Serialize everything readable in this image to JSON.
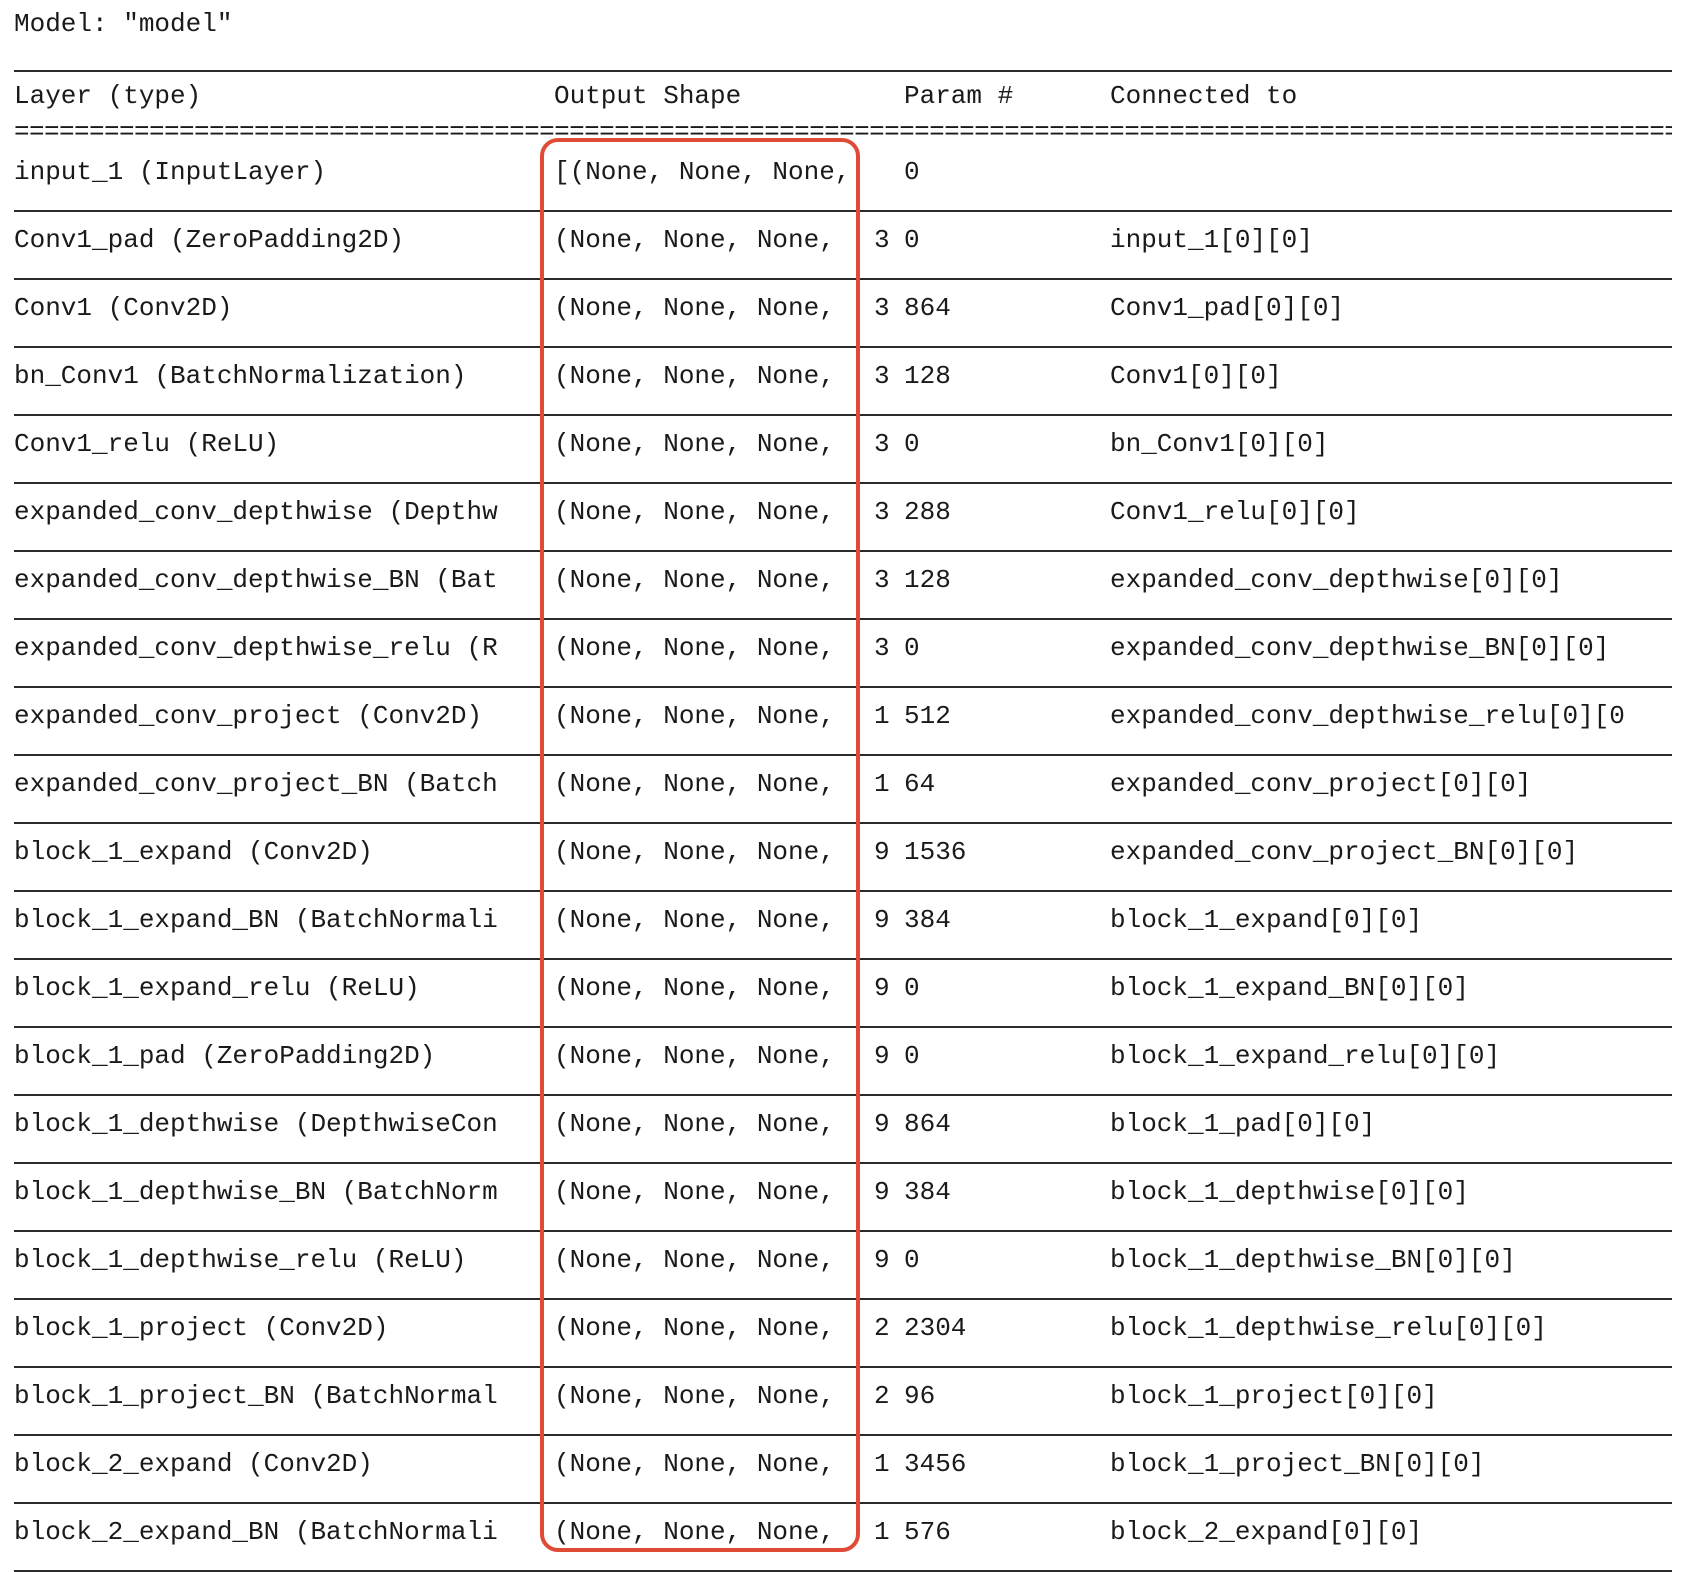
{
  "model_title": "Model: \"model\"",
  "header": {
    "layer_type": "Layer (type)",
    "output_shape": "Output Shape",
    "param": "Param #",
    "connected_to": "Connected to"
  },
  "separator": "==============================================================================================================================",
  "rows": [
    {
      "layer": "input_1 (InputLayer)",
      "shape": "[(None, None, None,",
      "shape_tail": "",
      "param": "0",
      "connected": ""
    },
    {
      "layer": "Conv1_pad (ZeroPadding2D)",
      "shape": "(None, None, None,",
      "shape_tail": "3",
      "param": "0",
      "connected": "input_1[0][0]"
    },
    {
      "layer": "Conv1 (Conv2D)",
      "shape": "(None, None, None,",
      "shape_tail": "3",
      "param": "864",
      "connected": "Conv1_pad[0][0]"
    },
    {
      "layer": "bn_Conv1 (BatchNormalization)",
      "shape": "(None, None, None,",
      "shape_tail": "3",
      "param": "128",
      "connected": "Conv1[0][0]"
    },
    {
      "layer": "Conv1_relu (ReLU)",
      "shape": "(None, None, None,",
      "shape_tail": "3",
      "param": "0",
      "connected": "bn_Conv1[0][0]"
    },
    {
      "layer": "expanded_conv_depthwise (Depthw",
      "shape": "(None, None, None,",
      "shape_tail": "3",
      "param": "288",
      "connected": "Conv1_relu[0][0]"
    },
    {
      "layer": "expanded_conv_depthwise_BN (Bat",
      "shape": "(None, None, None,",
      "shape_tail": "3",
      "param": "128",
      "connected": "expanded_conv_depthwise[0][0]"
    },
    {
      "layer": "expanded_conv_depthwise_relu (R",
      "shape": "(None, None, None,",
      "shape_tail": "3",
      "param": "0",
      "connected": "expanded_conv_depthwise_BN[0][0]"
    },
    {
      "layer": "expanded_conv_project (Conv2D)",
      "shape": "(None, None, None,",
      "shape_tail": "1",
      "param": "512",
      "connected": "expanded_conv_depthwise_relu[0][0"
    },
    {
      "layer": "expanded_conv_project_BN (Batch",
      "shape": "(None, None, None,",
      "shape_tail": "1",
      "param": "64",
      "connected": "expanded_conv_project[0][0]"
    },
    {
      "layer": "block_1_expand (Conv2D)",
      "shape": "(None, None, None,",
      "shape_tail": "9",
      "param": "1536",
      "connected": "expanded_conv_project_BN[0][0]"
    },
    {
      "layer": "block_1_expand_BN (BatchNormali",
      "shape": "(None, None, None,",
      "shape_tail": "9",
      "param": "384",
      "connected": "block_1_expand[0][0]"
    },
    {
      "layer": "block_1_expand_relu (ReLU)",
      "shape": "(None, None, None,",
      "shape_tail": "9",
      "param": "0",
      "connected": "block_1_expand_BN[0][0]"
    },
    {
      "layer": "block_1_pad (ZeroPadding2D)",
      "shape": "(None, None, None,",
      "shape_tail": "9",
      "param": "0",
      "connected": "block_1_expand_relu[0][0]"
    },
    {
      "layer": "block_1_depthwise (DepthwiseCon",
      "shape": "(None, None, None,",
      "shape_tail": "9",
      "param": "864",
      "connected": "block_1_pad[0][0]"
    },
    {
      "layer": "block_1_depthwise_BN (BatchNorm",
      "shape": "(None, None, None,",
      "shape_tail": "9",
      "param": "384",
      "connected": "block_1_depthwise[0][0]"
    },
    {
      "layer": "block_1_depthwise_relu (ReLU)",
      "shape": "(None, None, None,",
      "shape_tail": "9",
      "param": "0",
      "connected": "block_1_depthwise_BN[0][0]"
    },
    {
      "layer": "block_1_project (Conv2D)",
      "shape": "(None, None, None,",
      "shape_tail": "2",
      "param": "2304",
      "connected": "block_1_depthwise_relu[0][0]"
    },
    {
      "layer": "block_1_project_BN (BatchNormal",
      "shape": "(None, None, None,",
      "shape_tail": "2",
      "param": "96",
      "connected": "block_1_project[0][0]"
    },
    {
      "layer": "block_2_expand (Conv2D)",
      "shape": "(None, None, None,",
      "shape_tail": "1",
      "param": "3456",
      "connected": "block_1_project_BN[0][0]"
    },
    {
      "layer": "block_2_expand_BN (BatchNormali",
      "shape": "(None, None, None,",
      "shape_tail": "1",
      "param": "576",
      "connected": "block_2_expand[0][0]"
    }
  ],
  "colors": {
    "highlight": "#e04b36",
    "text": "#1a1a1a",
    "rule": "#2b2b2b"
  }
}
